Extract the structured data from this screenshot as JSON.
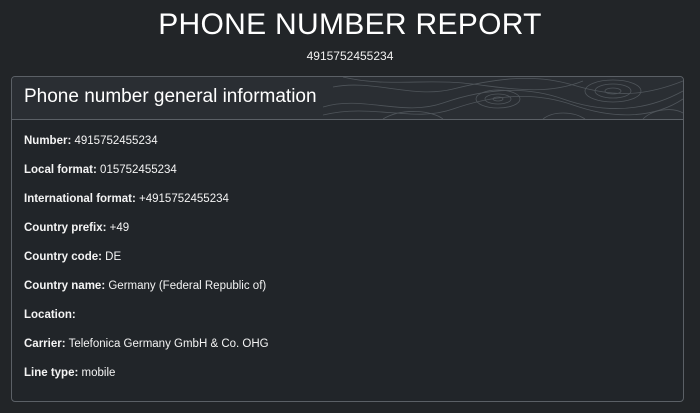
{
  "report": {
    "title": "PHONE NUMBER REPORT",
    "number": "4915752455234"
  },
  "card": {
    "title": "Phone number general information",
    "rows": [
      {
        "label": "Number:",
        "value": "4915752455234"
      },
      {
        "label": "Local format:",
        "value": "015752455234"
      },
      {
        "label": "International format:",
        "value": "+4915752455234"
      },
      {
        "label": "Country prefix:",
        "value": "+49"
      },
      {
        "label": "Country code:",
        "value": "DE"
      },
      {
        "label": "Country name:",
        "value": "Germany (Federal Republic of)"
      },
      {
        "label": "Location:",
        "value": ""
      },
      {
        "label": "Carrier:",
        "value": "Telefonica Germany GmbH & Co. OHG"
      },
      {
        "label": "Line type:",
        "value": "mobile"
      }
    ]
  },
  "colors": {
    "background": "#222528",
    "card_border": "#5b6066",
    "header_background": "#2a2e33",
    "text": "#ffffff"
  }
}
